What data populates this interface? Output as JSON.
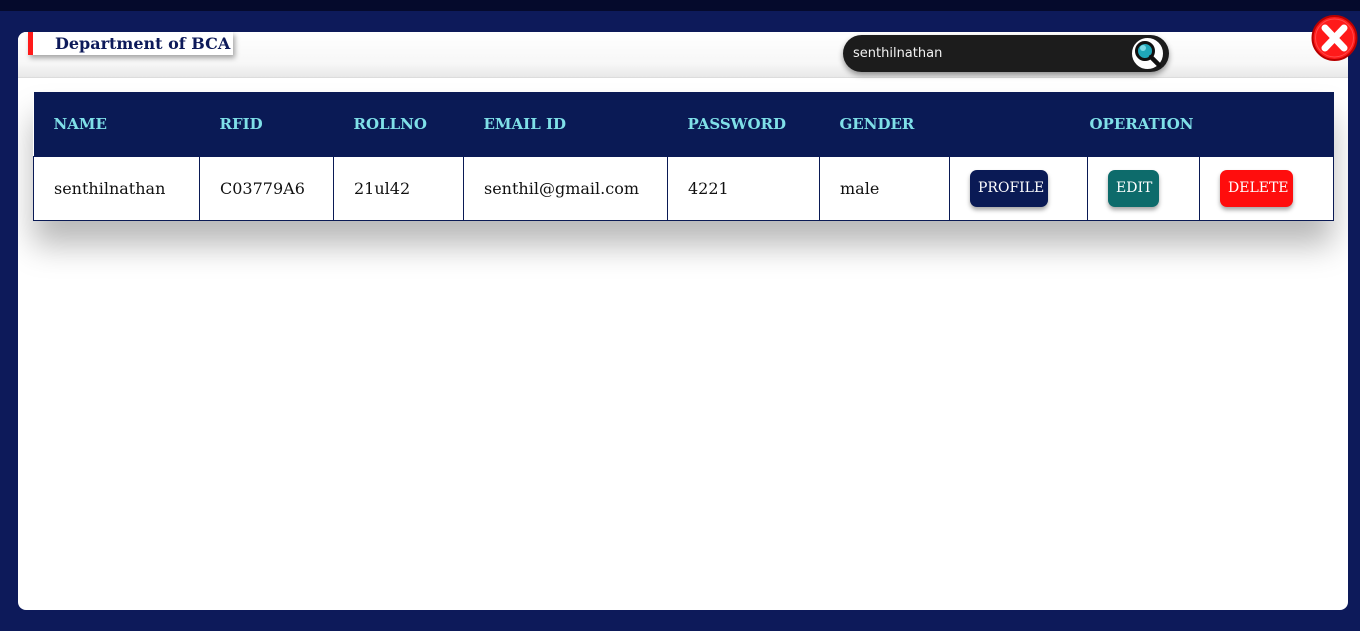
{
  "department": {
    "title": "Department of BCA"
  },
  "search": {
    "value": "senthilnathan",
    "placeholder": ""
  },
  "table": {
    "headers": {
      "name": "NAME",
      "rfid": "RFID",
      "rollno": "ROLLNO",
      "email": "EMAIL ID",
      "password": "PASSWORD",
      "gender": "GENDER",
      "operation": "OPERATION"
    },
    "rows": [
      {
        "name": "senthilnathan",
        "rfid": "C03779A6",
        "rollno": "21ul42",
        "email": "senthil@gmail.com",
        "password": "4221",
        "gender": "male",
        "profile_label": "PROFILE",
        "edit_label": "EDIT",
        "delete_label": "DELETE"
      }
    ]
  },
  "icons": {
    "search": "search-icon",
    "close": "close-icon"
  },
  "colors": {
    "navy": "#0a1a55",
    "header_text": "#7fe0e8",
    "edit": "#0d6b6b",
    "delete": "#ff0d0d",
    "close": "#ff1a1a"
  }
}
